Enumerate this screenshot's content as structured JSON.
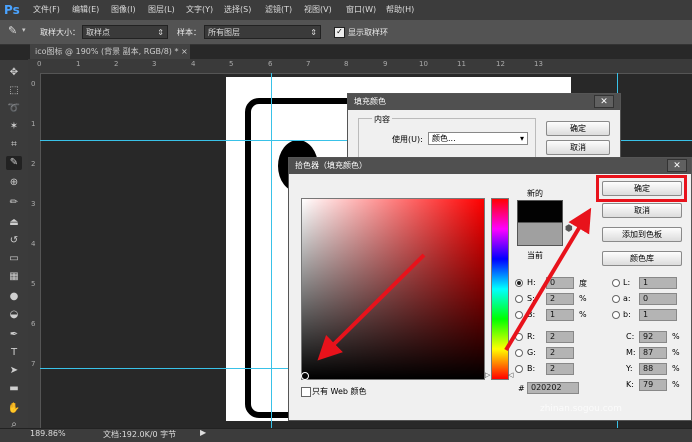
{
  "app": {
    "logo": "Ps"
  },
  "menu": [
    "文件(F)",
    "编辑(E)",
    "图像(I)",
    "图层(L)",
    "文字(Y)",
    "选择(S)",
    "滤镜(T)",
    "视图(V)",
    "窗口(W)",
    "帮助(H)"
  ],
  "options_bar": {
    "sample_size_label": "取样大小：",
    "sample_size_value": "取样点",
    "sample_label": "样本：",
    "sample_value": "所有图层",
    "show_ring_label": "显示取样环"
  },
  "document_tab": {
    "title": "ico图标 @ 190% (背景 副本, RGB/8) *",
    "close": "×"
  },
  "rulers": {
    "top": [
      "0",
      "1",
      "2",
      "3",
      "4",
      "5",
      "6",
      "7",
      "8",
      "9",
      "10",
      "11",
      "12",
      "13"
    ],
    "left": [
      "0",
      "1",
      "2",
      "3",
      "4",
      "5",
      "6",
      "7"
    ]
  },
  "status_bar": {
    "zoom": "189.86%",
    "doc": "文档:192.0K/0 字节"
  },
  "fill_dialog": {
    "title": "填充颜色",
    "close": "✕",
    "group_label": "内容",
    "use_label": "使用(U):",
    "use_value": "颜色...",
    "ok": "确定",
    "cancel": "取消"
  },
  "picker": {
    "title": "拾色器（填充颜色）",
    "close": "✕",
    "new_label": "新的",
    "current_label": "当前",
    "ok": "确定",
    "cancel": "取消",
    "add_swatch": "添加到色板",
    "color_library": "颜色库",
    "web_only_label": "只有 Web 颜色",
    "hsb": {
      "h_label": "H:",
      "h_value": "0",
      "h_unit": "度",
      "s_label": "S:",
      "s_value": "2",
      "s_unit": "%",
      "b_label": "B:",
      "b_value": "1",
      "b_unit": "%"
    },
    "rgb": {
      "r_label": "R:",
      "r_value": "2",
      "g_label": "G:",
      "g_value": "2",
      "b_label": "B:",
      "b_value": "2"
    },
    "lab": {
      "l_label": "L:",
      "l_value": "1",
      "a_label": "a:",
      "a_value": "0",
      "b_label": "b:",
      "b_value": "1"
    },
    "cmyk": {
      "c_label": "C:",
      "c_value": "92",
      "m_label": "M:",
      "m_value": "87",
      "y_label": "Y:",
      "y_value": "88",
      "k_label": "K:",
      "k_value": "79",
      "unit": "%"
    },
    "hex_label": "#",
    "hex_value": "020202"
  },
  "watermark": "zhinan.sogou.com",
  "colors": {
    "new_swatch": "#020202",
    "current_swatch": "#a0a0a0",
    "highlight": "#e8121b",
    "guide": "#39c2e8"
  }
}
